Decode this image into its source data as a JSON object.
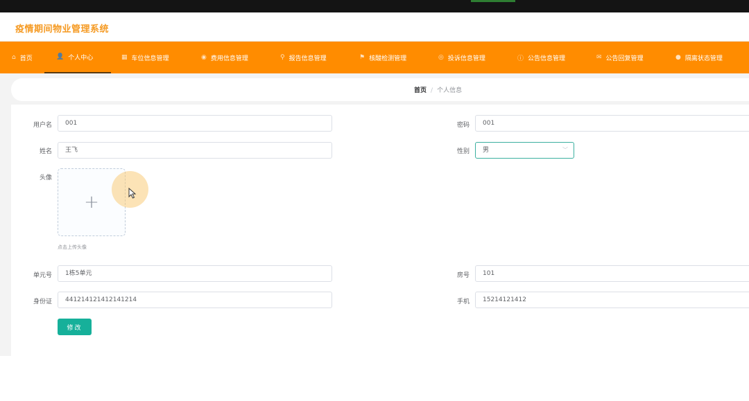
{
  "app": {
    "title": "疫情期间物业管理系统"
  },
  "nav": {
    "items": [
      {
        "label": "首页",
        "icon": "home-icon",
        "glyph": "⌂"
      },
      {
        "label": "个人中心",
        "icon": "user-icon",
        "glyph": "👤"
      },
      {
        "label": "车位信息管理",
        "icon": "grid-icon",
        "glyph": "▦"
      },
      {
        "label": "费用信息管理",
        "icon": "money-icon",
        "glyph": "◉"
      },
      {
        "label": "报告信息管理",
        "icon": "location-icon",
        "glyph": "⚲"
      },
      {
        "label": "核酸检测管理",
        "icon": "flag-icon",
        "glyph": "⚑"
      },
      {
        "label": "投诉信息管理",
        "icon": "compass-icon",
        "glyph": "◎"
      },
      {
        "label": "公告信息管理",
        "icon": "info-icon",
        "glyph": "ⓘ"
      },
      {
        "label": "公告回复管理",
        "icon": "message-icon",
        "glyph": "✉"
      },
      {
        "label": "隔离状态管理",
        "icon": "location-pin-icon",
        "glyph": "●"
      }
    ]
  },
  "breadcrumb": {
    "home": "首页",
    "separator": "/",
    "current": "个人信息"
  },
  "form": {
    "username": {
      "label": "用户名",
      "value": "001"
    },
    "password": {
      "label": "密码",
      "value": "001"
    },
    "name": {
      "label": "姓名",
      "value": "王飞"
    },
    "gender": {
      "label": "性别",
      "value": "男"
    },
    "avatar": {
      "label": "头像",
      "tip": "点击上传头像"
    },
    "unit": {
      "label": "单元号",
      "value": "1栋5单元"
    },
    "room": {
      "label": "房号",
      "value": "101"
    },
    "idcard": {
      "label": "身份证",
      "value": "441214121412141214"
    },
    "phone": {
      "label": "手机",
      "value": "15214121412"
    },
    "submit_label": "修改"
  },
  "colors": {
    "accent": "#ff8c00",
    "title": "#f59a23",
    "primary_button": "#16b09a"
  }
}
